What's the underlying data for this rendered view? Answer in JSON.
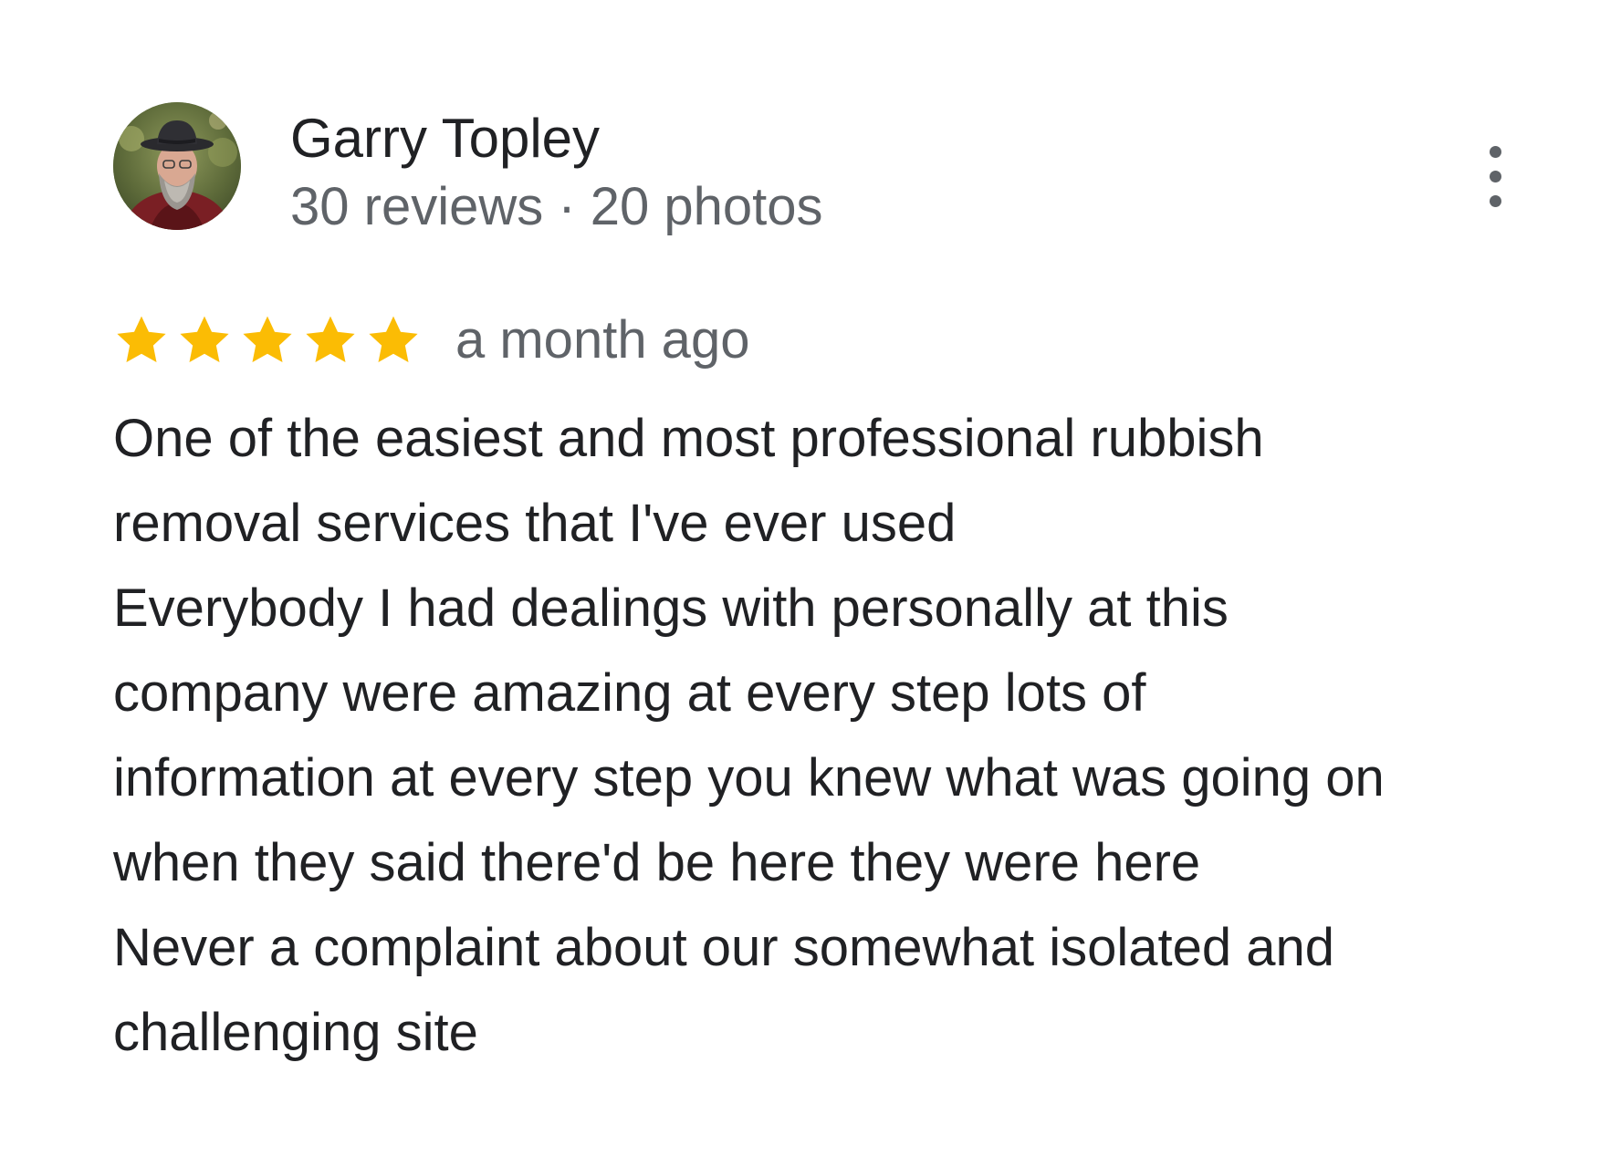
{
  "reviewer": {
    "name": "Garry Topley",
    "meta": "30 reviews · 20 photos",
    "avatar": "reviewer-avatar-photo"
  },
  "actions": {
    "more_icon": "more-vert-icon"
  },
  "rating": {
    "stars": 5,
    "max_stars": 5,
    "star_color": "#fbbc04",
    "timestamp": "a month ago"
  },
  "review": {
    "lines": [
      "One of the easiest and most professional rubbish",
      "removal services that I've ever used",
      "Everybody I had dealings with personally at this",
      "company were amazing at every step lots of",
      "information at every step you knew what was going on",
      "when they said there'd be here they were here",
      "Never a complaint about our somewhat isolated and",
      "challenging site"
    ]
  },
  "colors": {
    "primary_text": "#202124",
    "secondary_text": "#5f6368",
    "background": "#ffffff"
  }
}
